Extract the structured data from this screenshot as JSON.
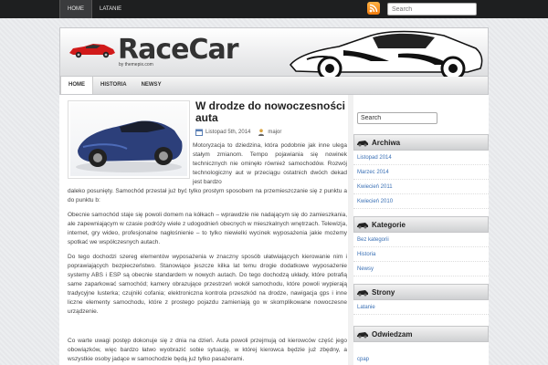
{
  "topnav": {
    "items": [
      {
        "label": "HOME"
      },
      {
        "label": "LATANIE"
      }
    ]
  },
  "search": {
    "placeholder": "Search"
  },
  "logo": {
    "title": "RaceCar",
    "subtitle": "by themepix.com"
  },
  "mainnav": {
    "items": [
      {
        "label": "HOME"
      },
      {
        "label": "HISTORIA"
      },
      {
        "label": "NEWSY"
      }
    ]
  },
  "post": {
    "title": "W drodze do nowoczesności auta",
    "date": "Listopad 5th, 2014",
    "author": "major",
    "p1": "Motoryzacja to dziedzina, która podobnie jak inne ulega stałym zmianom. Tempo pojawiania się nowinek technicznych nie ominęło również samochodów. Rozwój technologiczny aut w przeciągu ostatnich dwóch dekad jest bardzo",
    "p1b": "daleko posunięty. Samochód przestał już być tylko prostym sposobem na przemieszczanie się z punktu a do punktu b:",
    "p2": "Obecnie samochód staje się powoli domem na kółkach – wprawdzie nie nadającym się do zamieszkania, ale zapewniającym w czasie podróży wiele z udogodnień obecnych w mieszkalnych wnętrzach. Telewizja, internet, gry wideo, profesjonalne nagłośnienie – to tylko niewielki wycinek wyposażenia jakie możemy spotkać we współczesnych autach.",
    "p3": "Do tego dochodzi szereg elementów wyposażenia w znaczny sposób ułatwiających kierowanie nim i poprawiających bezpieczeństwo. Stanowiące jeszcze kilka lat temu drogie dodatkowe wyposażenie systemy ABS i ESP są obecnie standardem w nowych autach. Do tego dochodzą układy, które potrafią same zaparkować samochód; kamery obrazujące przestrzeń wokół samochodu, które powoli wypierają tradycyjne lusterka; czujniki cofania; elektroniczna kontrola przeszkód na drodze, nawigacja gps i inne liczne elementy samochodu, które z prostego pojazdu zamieniają go w skomplikowane nowoczesne urządzenie.",
    "p4": "Co warte uwagi postęp dokonuje się z dnia na dzień. Auta powoli przejmują od kierowców część jego obowiązków, więc bardzo łatwo wyobrazić sobie sytuację, w której kierowca będzie już zbędny, a wszystkie osoby jadące w samochodzie będą już tylko pasażerami."
  },
  "sidebar": {
    "search_value": "Search",
    "archiwa": {
      "title": "Archiwa",
      "items": [
        {
          "label": "Listopad 2014"
        },
        {
          "label": "Marzec 2014"
        },
        {
          "label": "Kwiecień 2011"
        },
        {
          "label": "Kwiecień 2010"
        }
      ]
    },
    "kategorie": {
      "title": "Kategorie",
      "items": [
        {
          "label": "Bez kategorii"
        },
        {
          "label": "Historia"
        },
        {
          "label": "Newsy"
        }
      ]
    },
    "strony": {
      "title": "Strony",
      "items": [
        {
          "label": "Latanie"
        }
      ]
    },
    "odwiedzam": {
      "title": "Odwiedzam",
      "items": [
        {
          "label": "cpap"
        }
      ]
    }
  },
  "colors": {
    "link": "#3a70b5",
    "topbar": "#1e1f20",
    "rss": "#f07b0c"
  }
}
